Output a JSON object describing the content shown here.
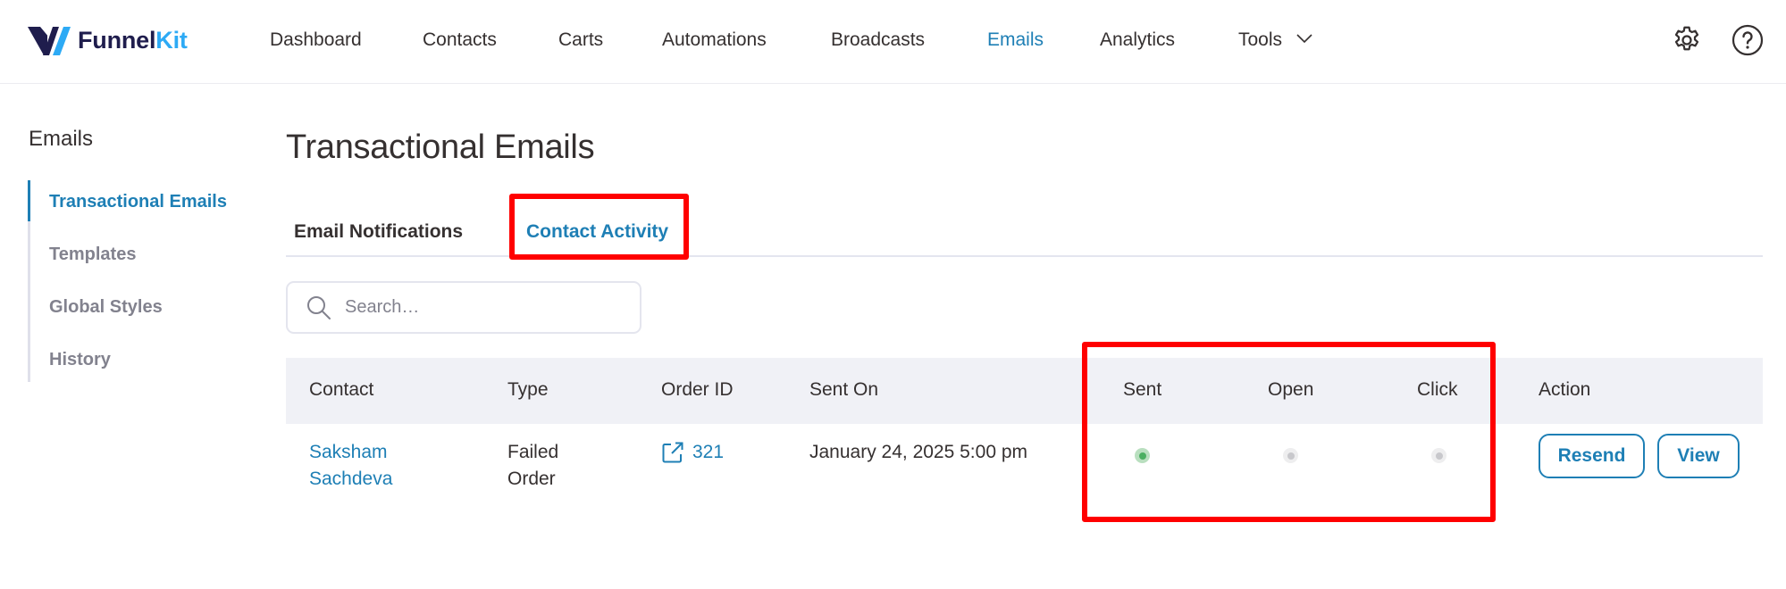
{
  "brand": {
    "name_part1": "Funnel",
    "name_part2": "Kit",
    "colors": {
      "dark": "#1f1d4d",
      "light": "#2daaf5"
    }
  },
  "nav": {
    "items": [
      {
        "label": "Dashboard"
      },
      {
        "label": "Contacts"
      },
      {
        "label": "Carts"
      },
      {
        "label": "Automations"
      },
      {
        "label": "Broadcasts"
      },
      {
        "label": "Emails",
        "active": true
      },
      {
        "label": "Analytics"
      },
      {
        "label": "Tools",
        "has_dropdown": true
      }
    ],
    "icons": [
      "gear-icon",
      "help-icon"
    ]
  },
  "sidebar": {
    "title": "Emails",
    "items": [
      {
        "label": "Transactional Emails",
        "active": true
      },
      {
        "label": "Templates"
      },
      {
        "label": "Global Styles"
      },
      {
        "label": "History"
      }
    ]
  },
  "main": {
    "title": "Transactional Emails",
    "tabs": [
      {
        "label": "Email Notifications"
      },
      {
        "label": "Contact Activity",
        "active": true
      }
    ],
    "search": {
      "placeholder": "Search…",
      "value": ""
    },
    "table": {
      "columns": [
        "Contact",
        "Type",
        "Order ID",
        "Sent On",
        "Sent",
        "Open",
        "Click",
        "Action"
      ],
      "rows": [
        {
          "contact_line1": "Saksham",
          "contact_line2": "Sachdeva",
          "type_line1": "Failed",
          "type_line2": "Order",
          "order_id": "321",
          "sent_on": "January 24, 2025 5:00 pm",
          "sent": true,
          "open": false,
          "click": false,
          "actions": [
            "Resend",
            "View"
          ]
        }
      ]
    }
  },
  "colors": {
    "accent": "#1e7fb5",
    "status_on": "#4caf62",
    "status_off": "#c8c8cc",
    "highlight": "#ff0000"
  }
}
